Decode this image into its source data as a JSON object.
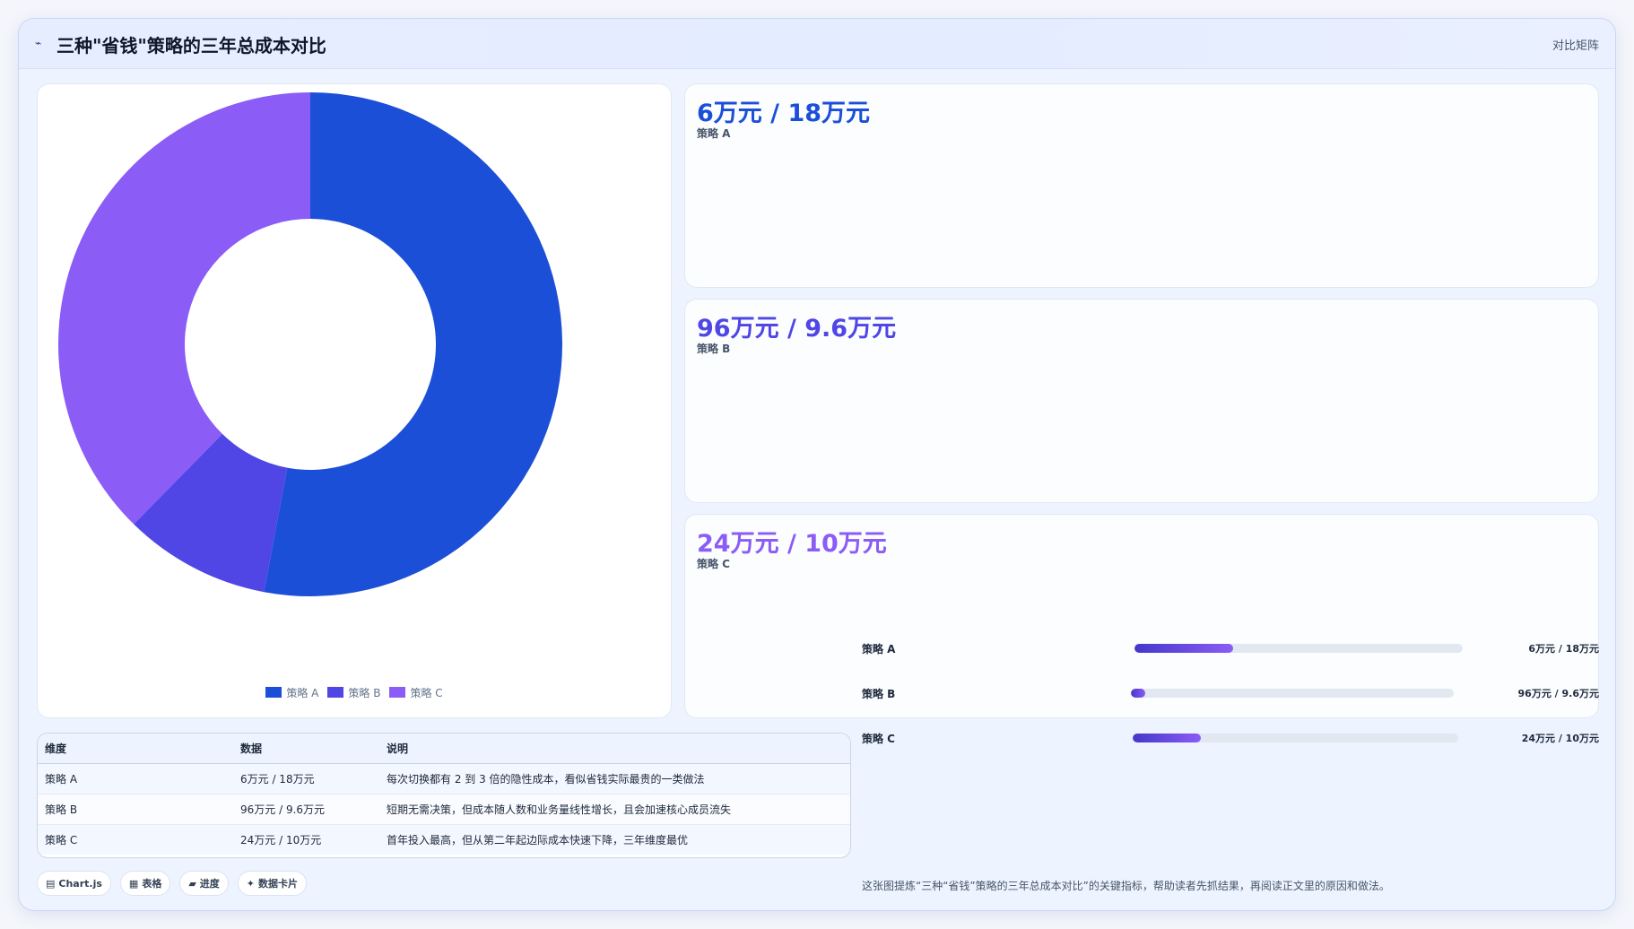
{
  "header": {
    "title": "三种\"省钱\"策略的三年总成本对比",
    "badge": "对比矩阵"
  },
  "colors": {
    "strategy_a": "#1c4fd8",
    "strategy_b": "#4f46e5",
    "strategy_c": "#8b5cf6"
  },
  "chart_data": {
    "type": "pie",
    "donut": true,
    "categories": [
      "策略 A",
      "策略 B",
      "策略 C"
    ],
    "values": [
      18,
      3.2,
      12.8
    ],
    "legend_position": "bottom"
  },
  "cards": [
    {
      "value": "6万元 / 18万元",
      "label": "策略 A"
    },
    {
      "value": "96万元 / 9.6万元",
      "label": "策略 B"
    },
    {
      "value": "24万元 / 10万元",
      "label": "策略 C"
    }
  ],
  "table": {
    "headers": [
      "维度",
      "数据",
      "说明"
    ],
    "rows": [
      [
        "策略 A",
        "6万元 / 18万元",
        "每次切换都有 2 到 3 倍的隐性成本，看似省钱实际最贵的一类做法"
      ],
      [
        "策略 B",
        "96万元 / 9.6万元",
        "短期无需决策，但成本随人数和业务量线性增长，且会加速核心成员流失"
      ],
      [
        "策略 C",
        "24万元 / 10万元",
        "首年投入最高，但从第二年起边际成本快速下降，三年维度最优"
      ]
    ]
  },
  "chips": [
    {
      "icon": "▤",
      "label": "Chart.js"
    },
    {
      "icon": "▦",
      "label": "表格"
    },
    {
      "icon": "▰",
      "label": "进度"
    },
    {
      "icon": "✦",
      "label": "数据卡片"
    }
  ],
  "progress": [
    {
      "label": "策略 A",
      "value": "6万元 / 18万元",
      "fraction": 0.3
    },
    {
      "label": "策略 B",
      "value": "96万元 / 9.6万元",
      "fraction": 0.045
    },
    {
      "label": "策略 C",
      "value": "24万元 / 10万元",
      "fraction": 0.21
    }
  ],
  "footnote": "这张图提炼“三种“省钱”策略的三年总成本对比”的关键指标，帮助读者先抓结果，再阅读正文里的原因和做法。"
}
